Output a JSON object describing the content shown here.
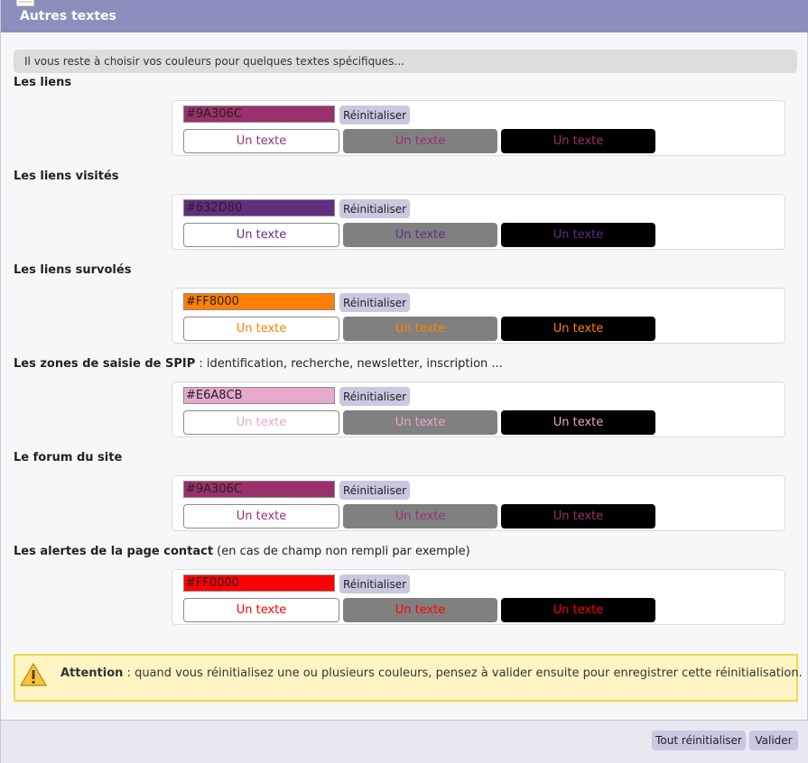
{
  "header": {
    "title": "Autres textes"
  },
  "intro": "Il vous reste à choisir vos couleurs pour quelques textes spécifiques...",
  "preview_text": "Un texte",
  "reset_label": "Réinitialiser",
  "sections": [
    {
      "label": "Les liens",
      "detail": "",
      "value": "#9A306C",
      "color": "#9A306C",
      "preview_text": "Un texte",
      "reset_label": "Réinitialiser"
    },
    {
      "label": "Les liens visités",
      "detail": "",
      "value": "#632D80",
      "color": "#632D80",
      "preview_text": "Un texte",
      "reset_label": "Réinitialiser"
    },
    {
      "label": "Les liens survolés",
      "detail": "",
      "value": "#FF8000",
      "color": "#FF8000",
      "preview_text": "Un texte",
      "reset_label": "Réinitialiser"
    },
    {
      "label": "Les zones de saisie de SPIP",
      "detail": " : identification, recherche, newsletter, inscription ...",
      "value": "#E6A8CB",
      "color": "#E6A8CB",
      "preview_text": "Un texte",
      "reset_label": "Réinitialiser"
    },
    {
      "label": "Le forum du site",
      "detail": "",
      "value": "#9A306C",
      "color": "#9A306C",
      "preview_text": "Un texte",
      "reset_label": "Réinitialiser"
    },
    {
      "label": "Les alertes de la page contact",
      "detail": " (en cas de champ non rempli par exemple)",
      "value": "#FF0000",
      "color": "#FF0000",
      "preview_text": "Un texte",
      "reset_label": "Réinitialiser"
    }
  ],
  "warning": {
    "title": "Attention",
    "text": " : quand vous réinitialisez une ou plusieurs couleurs, pensez à valider ensuite pour enregistrer cette réinitialisation.",
    "icon": "warning-icon"
  },
  "footer": {
    "reset_all_label": "Tout réinitialiser",
    "submit_label": "Valider"
  },
  "colors": {
    "titlebar": "#8C8FBE",
    "button": "#C8C8E0",
    "warning_bg": "#FFF5C4",
    "warning_border": "#F0D84A"
  }
}
